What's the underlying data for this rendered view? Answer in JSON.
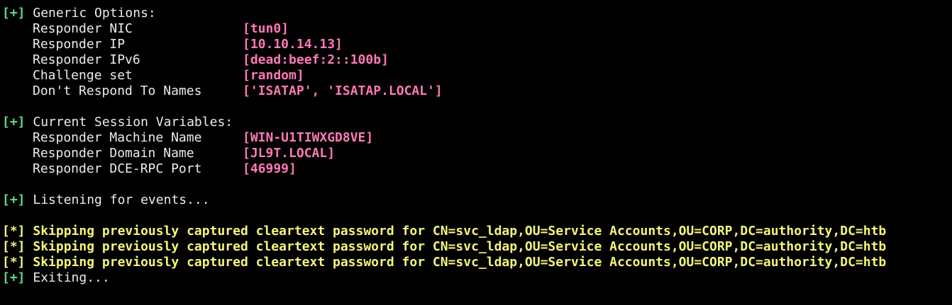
{
  "terminal": {
    "generic": {
      "tag": "[+]",
      "heading": "Generic Options:",
      "rows": [
        {
          "label": "Responder NIC",
          "value": "[tun0]"
        },
        {
          "label": "Responder IP",
          "value": "[10.10.14.13]"
        },
        {
          "label": "Responder IPv6",
          "value": "[dead:beef:2::100b]"
        },
        {
          "label": "Challenge set",
          "value": "[random]"
        },
        {
          "label": "Don't Respond To Names",
          "value": "['ISATAP', 'ISATAP.LOCAL']"
        }
      ]
    },
    "session": {
      "tag": "[+]",
      "heading": "Current Session Variables:",
      "rows": [
        {
          "label": "Responder Machine Name",
          "value": "[WIN-U1TIWXGD8VE]"
        },
        {
          "label": "Responder Domain Name",
          "value": "[JL9T.LOCAL]"
        },
        {
          "label": "Responder DCE-RPC Port",
          "value": "[46999]"
        }
      ]
    },
    "listening": {
      "tag": "[+]",
      "text": "Listening for events..."
    },
    "skips": [
      {
        "tag": "[*]",
        "text": "Skipping previously captured cleartext password for CN=svc_ldap,OU=Service Accounts,OU=CORP,DC=authority,DC=htb"
      },
      {
        "tag": "[*]",
        "text": "Skipping previously captured cleartext password for CN=svc_ldap,OU=Service Accounts,OU=CORP,DC=authority,DC=htb"
      },
      {
        "tag": "[*]",
        "text": "Skipping previously captured cleartext password for CN=svc_ldap,OU=Service Accounts,OU=CORP,DC=authority,DC=htb"
      }
    ],
    "exiting": {
      "tag": "[+]",
      "text": "Exiting..."
    }
  },
  "colors": {
    "background": "#000000",
    "tag_ok": "#5fd787",
    "tag_info": "#f5f57a",
    "value": "#ff79b6",
    "text": "#ececec"
  }
}
